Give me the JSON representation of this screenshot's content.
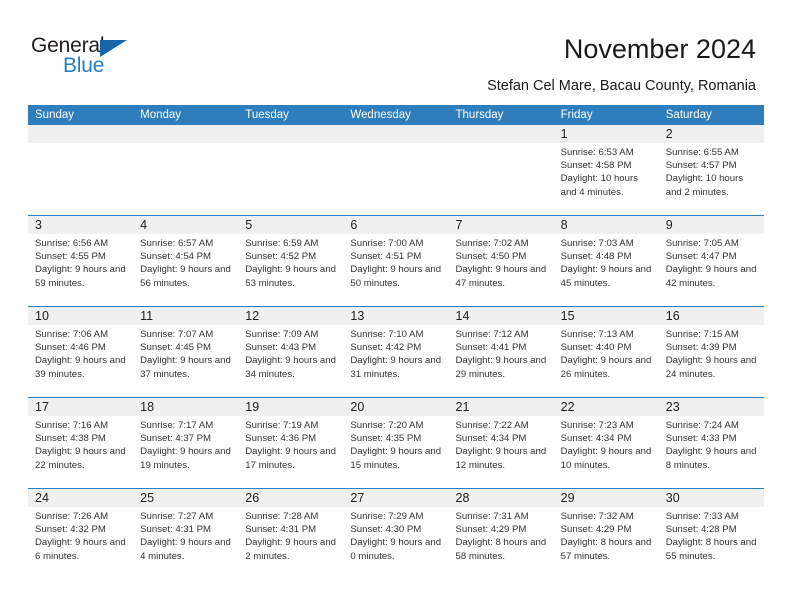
{
  "logo": {
    "word1": "General",
    "word2": "Blue",
    "triangle_color": "#1565a8",
    "blue_color": "#2a7ec4"
  },
  "header": {
    "title": "November 2024",
    "subtitle": "Stefan Cel Mare, Bacau County, Romania",
    "accent_color": "#2e7ebd",
    "daynum_band_color": "#f0f0f0"
  },
  "calendar": {
    "weekday_headers": [
      "Sunday",
      "Monday",
      "Tuesday",
      "Wednesday",
      "Thursday",
      "Friday",
      "Saturday"
    ],
    "weeks": [
      [
        {
          "day": "",
          "empty": true
        },
        {
          "day": "",
          "empty": true
        },
        {
          "day": "",
          "empty": true
        },
        {
          "day": "",
          "empty": true
        },
        {
          "day": "",
          "empty": true
        },
        {
          "day": "1",
          "sunrise": "Sunrise: 6:53 AM",
          "sunset": "Sunset: 4:58 PM",
          "daylight": "Daylight: 10 hours and 4 minutes."
        },
        {
          "day": "2",
          "sunrise": "Sunrise: 6:55 AM",
          "sunset": "Sunset: 4:57 PM",
          "daylight": "Daylight: 10 hours and 2 minutes."
        }
      ],
      [
        {
          "day": "3",
          "sunrise": "Sunrise: 6:56 AM",
          "sunset": "Sunset: 4:55 PM",
          "daylight": "Daylight: 9 hours and 59 minutes."
        },
        {
          "day": "4",
          "sunrise": "Sunrise: 6:57 AM",
          "sunset": "Sunset: 4:54 PM",
          "daylight": "Daylight: 9 hours and 56 minutes."
        },
        {
          "day": "5",
          "sunrise": "Sunrise: 6:59 AM",
          "sunset": "Sunset: 4:52 PM",
          "daylight": "Daylight: 9 hours and 53 minutes."
        },
        {
          "day": "6",
          "sunrise": "Sunrise: 7:00 AM",
          "sunset": "Sunset: 4:51 PM",
          "daylight": "Daylight: 9 hours and 50 minutes."
        },
        {
          "day": "7",
          "sunrise": "Sunrise: 7:02 AM",
          "sunset": "Sunset: 4:50 PM",
          "daylight": "Daylight: 9 hours and 47 minutes."
        },
        {
          "day": "8",
          "sunrise": "Sunrise: 7:03 AM",
          "sunset": "Sunset: 4:48 PM",
          "daylight": "Daylight: 9 hours and 45 minutes."
        },
        {
          "day": "9",
          "sunrise": "Sunrise: 7:05 AM",
          "sunset": "Sunset: 4:47 PM",
          "daylight": "Daylight: 9 hours and 42 minutes."
        }
      ],
      [
        {
          "day": "10",
          "sunrise": "Sunrise: 7:06 AM",
          "sunset": "Sunset: 4:46 PM",
          "daylight": "Daylight: 9 hours and 39 minutes."
        },
        {
          "day": "11",
          "sunrise": "Sunrise: 7:07 AM",
          "sunset": "Sunset: 4:45 PM",
          "daylight": "Daylight: 9 hours and 37 minutes."
        },
        {
          "day": "12",
          "sunrise": "Sunrise: 7:09 AM",
          "sunset": "Sunset: 4:43 PM",
          "daylight": "Daylight: 9 hours and 34 minutes."
        },
        {
          "day": "13",
          "sunrise": "Sunrise: 7:10 AM",
          "sunset": "Sunset: 4:42 PM",
          "daylight": "Daylight: 9 hours and 31 minutes."
        },
        {
          "day": "14",
          "sunrise": "Sunrise: 7:12 AM",
          "sunset": "Sunset: 4:41 PM",
          "daylight": "Daylight: 9 hours and 29 minutes."
        },
        {
          "day": "15",
          "sunrise": "Sunrise: 7:13 AM",
          "sunset": "Sunset: 4:40 PM",
          "daylight": "Daylight: 9 hours and 26 minutes."
        },
        {
          "day": "16",
          "sunrise": "Sunrise: 7:15 AM",
          "sunset": "Sunset: 4:39 PM",
          "daylight": "Daylight: 9 hours and 24 minutes."
        }
      ],
      [
        {
          "day": "17",
          "sunrise": "Sunrise: 7:16 AM",
          "sunset": "Sunset: 4:38 PM",
          "daylight": "Daylight: 9 hours and 22 minutes."
        },
        {
          "day": "18",
          "sunrise": "Sunrise: 7:17 AM",
          "sunset": "Sunset: 4:37 PM",
          "daylight": "Daylight: 9 hours and 19 minutes."
        },
        {
          "day": "19",
          "sunrise": "Sunrise: 7:19 AM",
          "sunset": "Sunset: 4:36 PM",
          "daylight": "Daylight: 9 hours and 17 minutes."
        },
        {
          "day": "20",
          "sunrise": "Sunrise: 7:20 AM",
          "sunset": "Sunset: 4:35 PM",
          "daylight": "Daylight: 9 hours and 15 minutes."
        },
        {
          "day": "21",
          "sunrise": "Sunrise: 7:22 AM",
          "sunset": "Sunset: 4:34 PM",
          "daylight": "Daylight: 9 hours and 12 minutes."
        },
        {
          "day": "22",
          "sunrise": "Sunrise: 7:23 AM",
          "sunset": "Sunset: 4:34 PM",
          "daylight": "Daylight: 9 hours and 10 minutes."
        },
        {
          "day": "23",
          "sunrise": "Sunrise: 7:24 AM",
          "sunset": "Sunset: 4:33 PM",
          "daylight": "Daylight: 9 hours and 8 minutes."
        }
      ],
      [
        {
          "day": "24",
          "sunrise": "Sunrise: 7:26 AM",
          "sunset": "Sunset: 4:32 PM",
          "daylight": "Daylight: 9 hours and 6 minutes."
        },
        {
          "day": "25",
          "sunrise": "Sunrise: 7:27 AM",
          "sunset": "Sunset: 4:31 PM",
          "daylight": "Daylight: 9 hours and 4 minutes."
        },
        {
          "day": "26",
          "sunrise": "Sunrise: 7:28 AM",
          "sunset": "Sunset: 4:31 PM",
          "daylight": "Daylight: 9 hours and 2 minutes."
        },
        {
          "day": "27",
          "sunrise": "Sunrise: 7:29 AM",
          "sunset": "Sunset: 4:30 PM",
          "daylight": "Daylight: 9 hours and 0 minutes."
        },
        {
          "day": "28",
          "sunrise": "Sunrise: 7:31 AM",
          "sunset": "Sunset: 4:29 PM",
          "daylight": "Daylight: 8 hours and 58 minutes."
        },
        {
          "day": "29",
          "sunrise": "Sunrise: 7:32 AM",
          "sunset": "Sunset: 4:29 PM",
          "daylight": "Daylight: 8 hours and 57 minutes."
        },
        {
          "day": "30",
          "sunrise": "Sunrise: 7:33 AM",
          "sunset": "Sunset: 4:28 PM",
          "daylight": "Daylight: 8 hours and 55 minutes."
        }
      ]
    ]
  }
}
